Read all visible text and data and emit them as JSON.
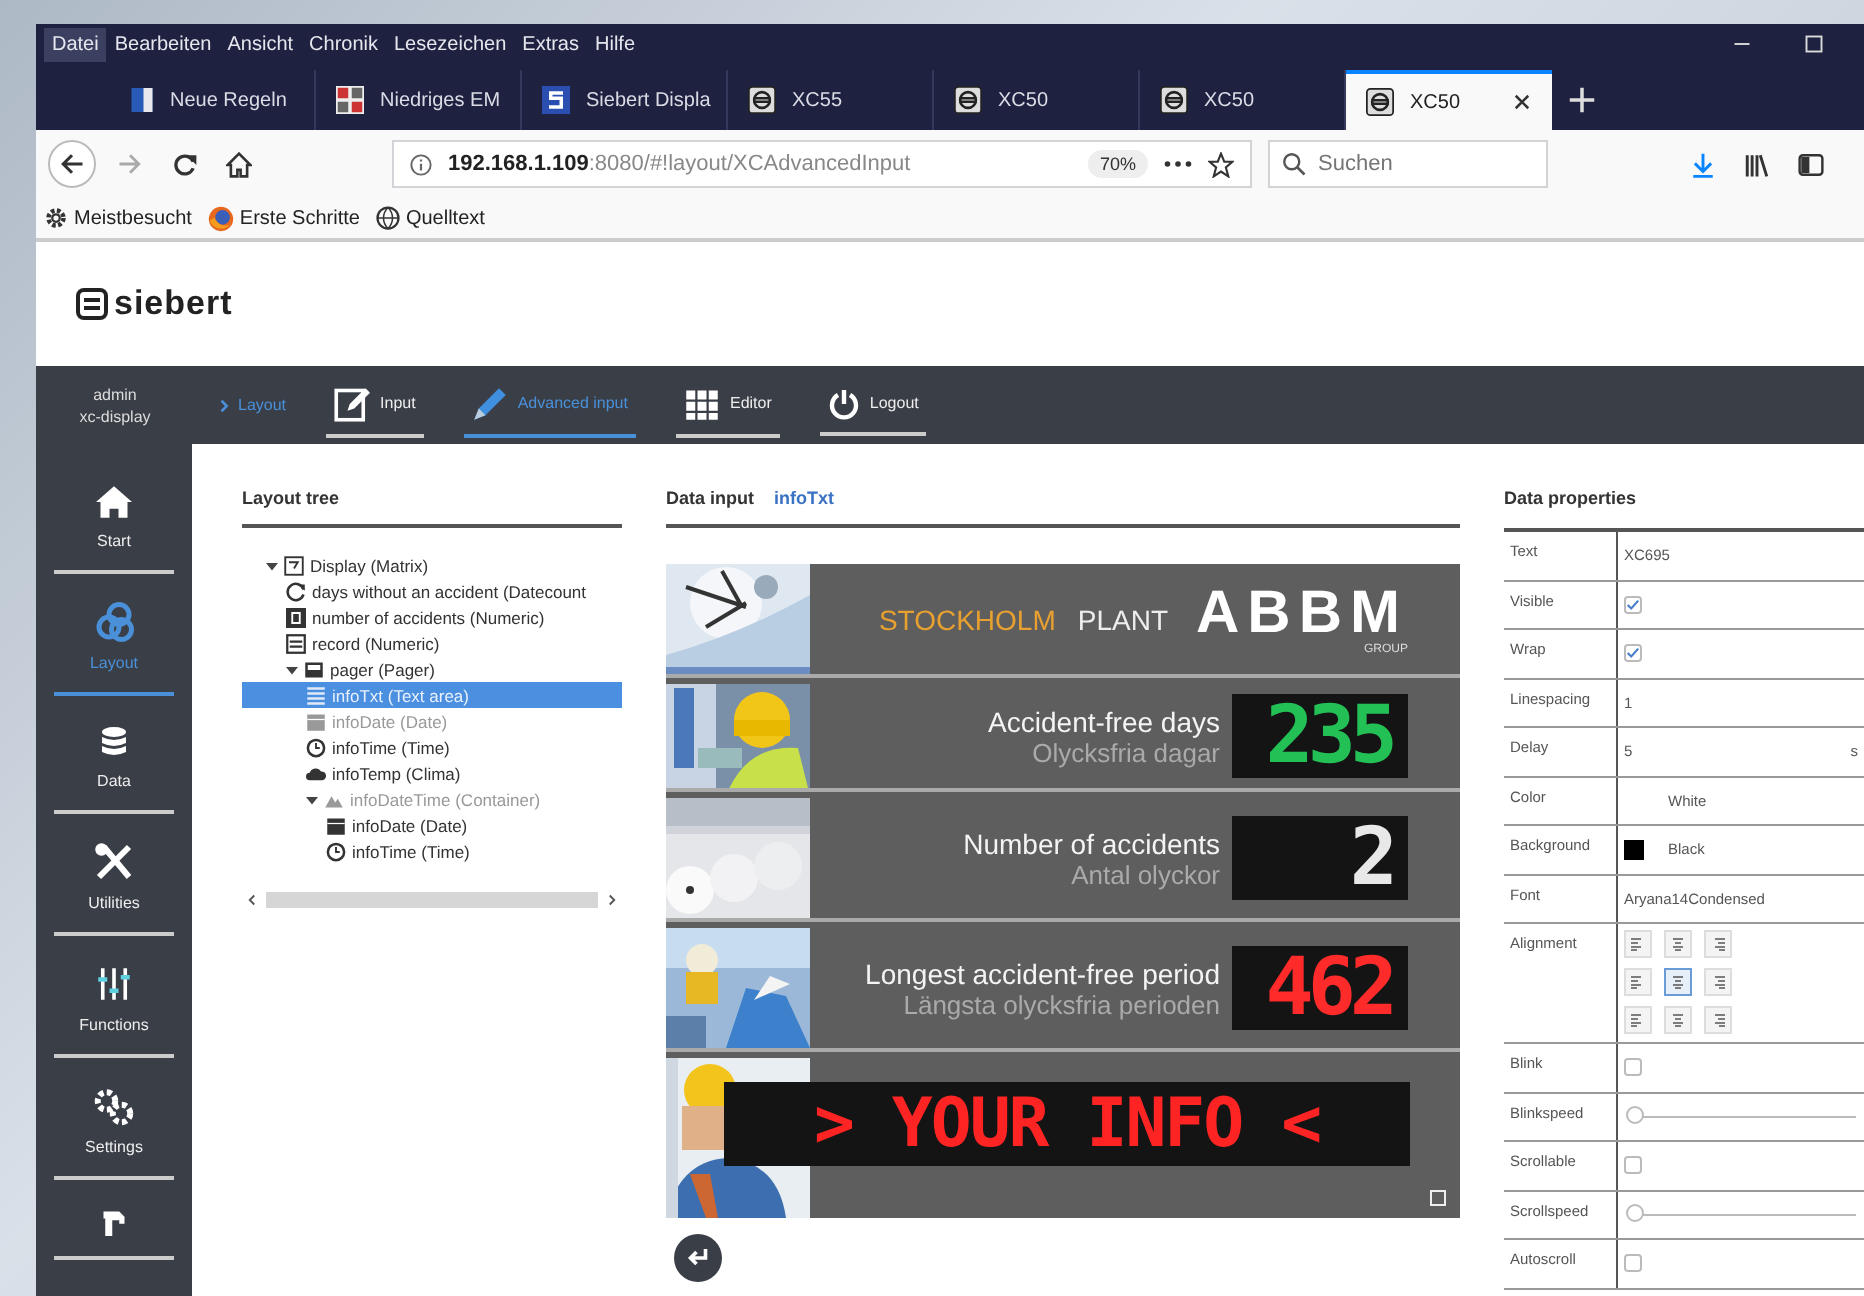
{
  "menu_bar": [
    {
      "label": "Datei",
      "selected": true
    },
    {
      "label": "Bearbeiten",
      "selected": false
    },
    {
      "label": "Ansicht",
      "selected": false
    },
    {
      "label": "Chronik",
      "selected": false
    },
    {
      "label": "Lesezeichen",
      "selected": false
    },
    {
      "label": "Extras",
      "selected": false
    },
    {
      "label": "Hilfe",
      "selected": false
    }
  ],
  "tabs": [
    {
      "label": "Neue Regeln",
      "kind": "page",
      "selected": false
    },
    {
      "label": "Niedriges EM",
      "kind": "grid",
      "selected": false
    },
    {
      "label": "Siebert Displa",
      "kind": "letter",
      "selected": false
    },
    {
      "label": "XC55",
      "kind": "device",
      "selected": false
    },
    {
      "label": "XC50",
      "kind": "device",
      "selected": false
    },
    {
      "label": "XC50",
      "kind": "device",
      "selected": false
    },
    {
      "label": "XC50",
      "kind": "device",
      "selected": true
    }
  ],
  "address_bar": {
    "url": "**192.168.1.109**:8080/#!layout/XCAdvancedInput",
    "zoom": "70%"
  },
  "search": {
    "placeholder": "Suchen"
  },
  "bookmarks": [
    {
      "label": "Meistbesucht",
      "kind": "gear"
    },
    {
      "label": "Erste Schritte",
      "kind": "fox"
    },
    {
      "label": "Quelltext",
      "kind": "globe"
    }
  ],
  "app": {
    "logo": "siebert",
    "user": {
      "name": "admin",
      "device": "xc-display"
    },
    "breadcrumb": "Layout",
    "nav": [
      {
        "label": "Input",
        "kind": "input",
        "selected": false
      },
      {
        "label": "Advanced input",
        "kind": "advanced",
        "selected": true
      },
      {
        "label": "Editor",
        "kind": "editor",
        "selected": false
      },
      {
        "label": "Logout",
        "kind": "logout",
        "selected": false
      }
    ]
  },
  "sidebar": [
    {
      "label": "Start",
      "kind": "home",
      "selected": false
    },
    {
      "label": "Layout",
      "kind": "layout",
      "selected": true
    },
    {
      "label": "Data",
      "kind": "data",
      "selected": false
    },
    {
      "label": "Utilities",
      "kind": "utilities",
      "selected": false
    },
    {
      "label": "Functions",
      "kind": "functions",
      "selected": false
    },
    {
      "label": "Settings",
      "kind": "settings",
      "selected": false
    },
    {
      "kind": "service",
      "selected": false
    }
  ],
  "layout_tree": {
    "title": "Layout tree",
    "items": [
      {
        "label": "Display (Matrix)",
        "kind": "display",
        "expanded": true,
        "selected": false,
        "disabled": false,
        "children": [
          {
            "label": "days without an accident (Datecount",
            "kind": "counter",
            "selected": false,
            "disabled": false
          },
          {
            "label": "number of accidents (Numeric)",
            "kind": "numeric",
            "selected": false,
            "disabled": false
          },
          {
            "label": "record (Numeric)",
            "kind": "record",
            "selected": false,
            "disabled": false
          },
          {
            "label": "pager (Pager)",
            "kind": "pager",
            "expanded": true,
            "selected": false,
            "disabled": false,
            "children": [
              {
                "label": "infoTxt (Text area)",
                "kind": "text",
                "selected": true,
                "disabled": false
              },
              {
                "label": "infoDate (Date)",
                "kind": "date",
                "selected": false,
                "disabled": true
              },
              {
                "label": "infoTime (Time)",
                "kind": "time",
                "selected": false,
                "disabled": false
              },
              {
                "label": "infoTemp (Clima)",
                "kind": "clima",
                "selected": false,
                "disabled": false
              },
              {
                "label": "infoDateTime (Container)",
                "kind": "container",
                "expanded": true,
                "selected": false,
                "disabled": true,
                "children": [
                  {
                    "label": "infoDate (Date)",
                    "kind": "date",
                    "selected": false,
                    "disabled": false
                  },
                  {
                    "label": "infoTime (Time)",
                    "kind": "time",
                    "selected": false,
                    "disabled": false
                  }
                ]
              }
            ]
          }
        ]
      }
    ]
  },
  "data_input": {
    "title": "Data input",
    "element": "infoTxt",
    "display": {
      "plant": "STOCKHOLM",
      "plant_suffix": "PLANT",
      "brand": "ABBM",
      "brand_sub": "GROUP",
      "rows": [
        {
          "label": "Accident-free days",
          "sublabel": "Olycksfria dagar",
          "value": "235",
          "color": "#22c055"
        },
        {
          "label": "Number of accidents",
          "sublabel": "Antal olyckor",
          "value": "2",
          "color": "#e8e8e8"
        },
        {
          "label": "Longest accident-free period",
          "sublabel": "Längsta olycksfria perioden",
          "value": "462",
          "color": "#ff2a2a"
        }
      ],
      "ticker": "> YOUR INFO <"
    }
  },
  "data_properties": {
    "title": "Data properties",
    "rows": [
      {
        "label": "Text",
        "kind": "text",
        "value": "XC695"
      },
      {
        "label": "Visible",
        "kind": "checkbox",
        "checked": true
      },
      {
        "label": "Wrap",
        "kind": "checkbox",
        "checked": true
      },
      {
        "label": "Linespacing",
        "kind": "text",
        "value": "1"
      },
      {
        "label": "Delay",
        "kind": "number",
        "value": "5",
        "unit": "s"
      },
      {
        "label": "Color",
        "kind": "select",
        "value": "White"
      },
      {
        "label": "Background",
        "kind": "select",
        "value": "Black",
        "color": "#000000"
      },
      {
        "label": "Font",
        "kind": "text",
        "value": "Aryana14Condensed"
      },
      {
        "label": "Alignment",
        "kind": "alignment",
        "cells": [
          {
            "selected": false
          },
          {
            "selected": false
          },
          {
            "selected": false
          },
          {
            "selected": false
          },
          {
            "selected": true
          },
          {
            "selected": false
          },
          {
            "selected": false
          },
          {
            "selected": false
          },
          {
            "selected": false
          }
        ]
      },
      {
        "label": "Blink",
        "kind": "checkbox",
        "checked": false
      },
      {
        "label": "Blinkspeed",
        "kind": "slider",
        "level": 0
      },
      {
        "label": "Scrollable",
        "kind": "checkbox",
        "checked": false
      },
      {
        "label": "Scrollspeed",
        "kind": "slider",
        "level": 0
      },
      {
        "label": "Autoscroll",
        "kind": "checkbox",
        "checked": false
      }
    ]
  }
}
